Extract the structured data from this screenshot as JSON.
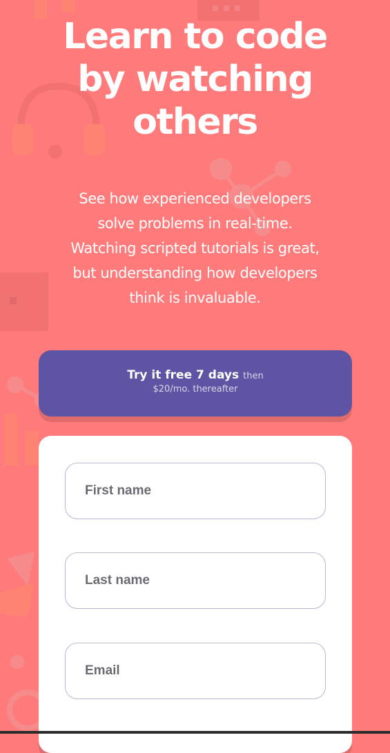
{
  "hero": {
    "title_lines": [
      "Learn to code",
      "by watching",
      "others"
    ],
    "description_lines": [
      "See how experienced developers",
      "solve problems in real-time.",
      "Watching scripted tutorials is great,",
      "but understanding how developers",
      "think is invaluable."
    ]
  },
  "trial": {
    "main": "Try it free 7 days",
    "then": "then",
    "price": "$20/mo. thereafter"
  },
  "form": {
    "first_name_placeholder": "First name",
    "last_name_placeholder": "Last name",
    "email_placeholder": "Email"
  },
  "colors": {
    "background": "#ff7a7a",
    "banner": "#5e54a4",
    "card": "#ffffff",
    "field_border": "#b9b6d3"
  },
  "icons": [
    "headset-icon",
    "network-icon",
    "chart-icon",
    "browser-window-icon",
    "shield-icon"
  ]
}
